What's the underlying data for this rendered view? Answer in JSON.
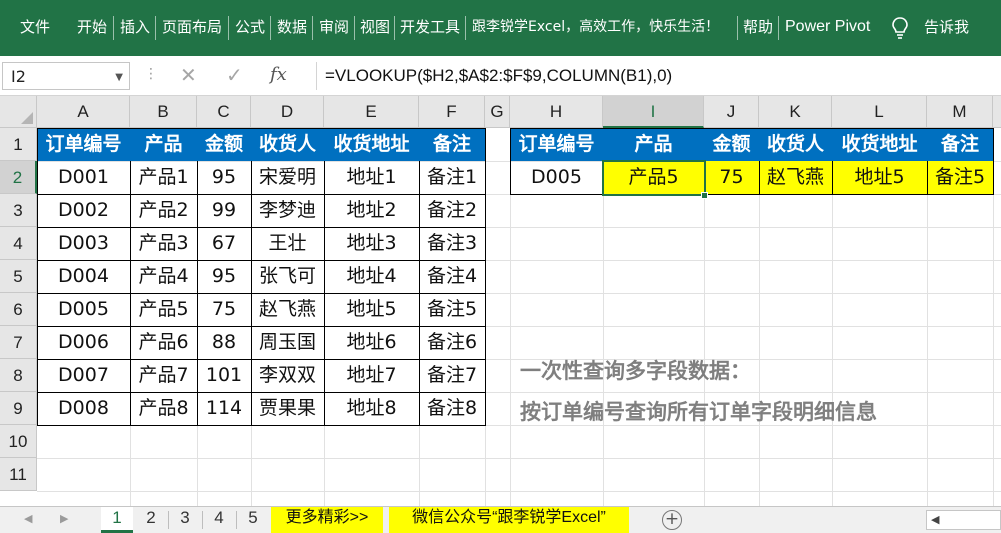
{
  "ribbon": {
    "items": [
      "文件",
      "开始",
      "插入",
      "页面布局",
      "公式",
      "数据",
      "审阅",
      "视图",
      "开发工具",
      "跟李锐学Excel，高效工作，快乐生活！",
      "帮助",
      "Power Pivot",
      "告诉我"
    ],
    "color": "#217346"
  },
  "formula_bar": {
    "name_box": "I2",
    "cancel_icon": "✕",
    "enter_icon": "✓",
    "fx_label": "fx",
    "formula": "=VLOOKUP($H2,$A$2:$F$9,COLUMN(B1),0)"
  },
  "grid": {
    "columns": [
      "A",
      "B",
      "C",
      "D",
      "E",
      "F",
      "G",
      "H",
      "I",
      "J",
      "K",
      "L",
      "M"
    ],
    "rows": [
      "1",
      "2",
      "3",
      "4",
      "5",
      "6",
      "7",
      "8",
      "9",
      "10",
      "11"
    ],
    "selected_cell": "I2",
    "header_fill": "#0070c0",
    "result_fill": "#ffff00"
  },
  "source_table": {
    "headers": [
      "订单编号",
      "产品",
      "金额",
      "收货人",
      "收货地址",
      "备注"
    ],
    "rows": [
      [
        "D001",
        "产品1",
        "95",
        "宋爱明",
        "地址1",
        "备注1"
      ],
      [
        "D002",
        "产品2",
        "99",
        "李梦迪",
        "地址2",
        "备注2"
      ],
      [
        "D003",
        "产品3",
        "67",
        "王壮",
        "地址3",
        "备注3"
      ],
      [
        "D004",
        "产品4",
        "95",
        "张飞可",
        "地址4",
        "备注4"
      ],
      [
        "D005",
        "产品5",
        "75",
        "赵飞燕",
        "地址5",
        "备注5"
      ],
      [
        "D006",
        "产品6",
        "88",
        "周玉国",
        "地址6",
        "备注6"
      ],
      [
        "D007",
        "产品7",
        "101",
        "李双双",
        "地址7",
        "备注7"
      ],
      [
        "D008",
        "产品8",
        "114",
        "贾果果",
        "地址8",
        "备注8"
      ]
    ]
  },
  "lookup_table": {
    "headers": [
      "订单编号",
      "产品",
      "金额",
      "收货人",
      "收货地址",
      "备注"
    ],
    "row": [
      "D005",
      "产品5",
      "75",
      "赵飞燕",
      "地址5",
      "备注5"
    ]
  },
  "notes": {
    "line1": "一次性查询多字段数据：",
    "line2": "按订单编号查询所有订单字段明细信息"
  },
  "sheet_tabs": {
    "tabs": [
      "1",
      "2",
      "3",
      "4",
      "5"
    ],
    "active": "1",
    "promo1": "更多精彩>>",
    "promo2": "微信公众号“跟李锐学Excel”"
  }
}
